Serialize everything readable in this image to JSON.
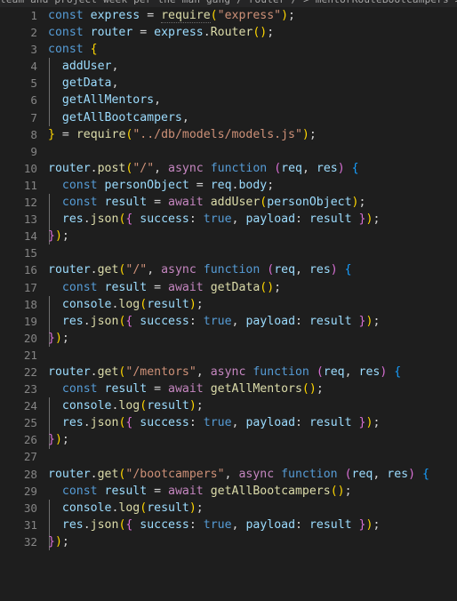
{
  "window": {
    "breadcrumb_sliver": "team and project week per the man gang / router /  > mentorRouteBootcampers > r",
    "background": "#1e1e1e",
    "gutter_color": "#858585"
  },
  "editor": {
    "language": "javascript",
    "total_lines": 32,
    "first_visible_line": 1,
    "last_visible_line": 32,
    "indent_guide_color": "#707070",
    "palette": {
      "keyword": "#569cd6",
      "identifier": "#9cdcfe",
      "function": "#dcdcaa",
      "string": "#ce9178",
      "control": "#c586c0",
      "bracket_1": "#ffd700",
      "bracket_2": "#da70d6",
      "bracket_3": "#179fff",
      "plain": "#d4d4d4"
    },
    "lines": [
      {
        "n": 1,
        "text": "const express = require(\"express\");"
      },
      {
        "n": 2,
        "text": "const router = express.Router();"
      },
      {
        "n": 3,
        "text": "const {"
      },
      {
        "n": 4,
        "text": "  addUser,"
      },
      {
        "n": 5,
        "text": "  getData,"
      },
      {
        "n": 6,
        "text": "  getAllMentors,"
      },
      {
        "n": 7,
        "text": "  getAllBootcampers,"
      },
      {
        "n": 8,
        "text": "} = require(\"../db/models/models.js\");"
      },
      {
        "n": 9,
        "text": ""
      },
      {
        "n": 10,
        "text": "router.post(\"/\", async function (req, res) {"
      },
      {
        "n": 11,
        "text": "  const personObject = req.body;"
      },
      {
        "n": 12,
        "text": "  const result = await addUser(personObject);"
      },
      {
        "n": 13,
        "text": "  res.json({ success: true, payload: result });"
      },
      {
        "n": 14,
        "text": "});"
      },
      {
        "n": 15,
        "text": ""
      },
      {
        "n": 16,
        "text": "router.get(\"/\", async function (req, res) {"
      },
      {
        "n": 17,
        "text": "  const result = await getData();"
      },
      {
        "n": 18,
        "text": "  console.log(result);"
      },
      {
        "n": 19,
        "text": "  res.json({ success: true, payload: result });"
      },
      {
        "n": 20,
        "text": "});"
      },
      {
        "n": 21,
        "text": ""
      },
      {
        "n": 22,
        "text": "router.get(\"/mentors\", async function (req, res) {"
      },
      {
        "n": 23,
        "text": "  const result = await getAllMentors();"
      },
      {
        "n": 24,
        "text": "  console.log(result);"
      },
      {
        "n": 25,
        "text": "  res.json({ success: true, payload: result });"
      },
      {
        "n": 26,
        "text": "});"
      },
      {
        "n": 27,
        "text": ""
      },
      {
        "n": 28,
        "text": "router.get(\"/bootcampers\", async function (req, res) {"
      },
      {
        "n": 29,
        "text": "  const result = await getAllBootcampers();"
      },
      {
        "n": 30,
        "text": "  console.log(result);"
      },
      {
        "n": 31,
        "text": "  res.json({ success: true, payload: result });"
      },
      {
        "n": 32,
        "text": "});"
      }
    ]
  }
}
